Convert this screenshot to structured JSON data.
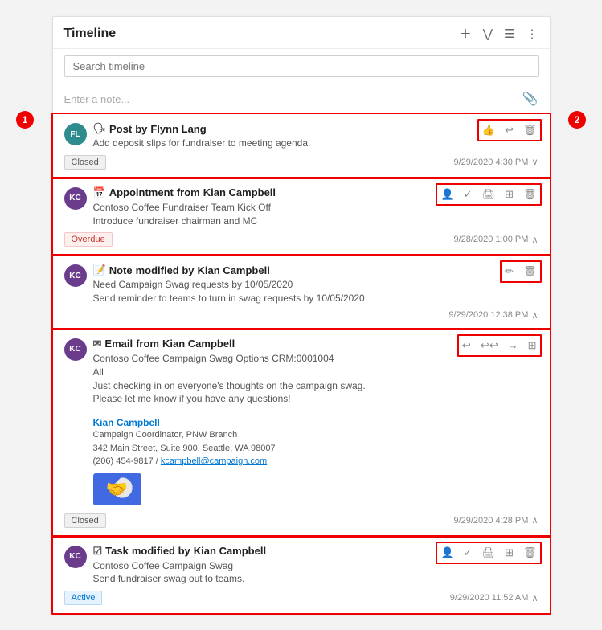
{
  "panel": {
    "title": "Timeline",
    "search_placeholder": "Search timeline",
    "note_placeholder": "Enter a note...",
    "header_actions": [
      "add",
      "filter",
      "sort",
      "more"
    ]
  },
  "annotations": {
    "circle1_label": "1",
    "circle2_label": "2"
  },
  "items": [
    {
      "id": "post-1",
      "type": "Post",
      "type_icon": "🗣",
      "author": "Flynn Lang",
      "avatar_initials": "FL",
      "avatar_class": "avatar-fl",
      "body_lines": [
        "Add deposit slips for fundraiser to meeting agenda."
      ],
      "badge": "Closed",
      "badge_class": "badge-closed",
      "timestamp": "9/29/2020 4:30 PM",
      "collapsed": false,
      "actions": [
        "thumbsup",
        "undo",
        "delete"
      ]
    },
    {
      "id": "appt-1",
      "type": "Appointment",
      "type_icon": "📅",
      "author": "Kian Campbell",
      "avatar_initials": "KC",
      "avatar_class": "avatar-kc",
      "body_lines": [
        "Contoso Coffee Fundraiser Team Kick Off",
        "Introduce fundraiser chairman and MC"
      ],
      "badge": "Overdue",
      "badge_class": "badge-overdue",
      "timestamp": "9/28/2020 1:00 PM",
      "collapsed": false,
      "actions": [
        "assign",
        "check",
        "print",
        "export",
        "delete"
      ]
    },
    {
      "id": "note-1",
      "type": "Note",
      "type_icon": "📝",
      "author": "Kian Campbell",
      "avatar_initials": "KC",
      "avatar_class": "avatar-kc",
      "body_lines": [
        "Need Campaign Swag requests by 10/05/2020",
        "Send reminder to teams to turn in swag requests by 10/05/2020"
      ],
      "badge": null,
      "timestamp": "9/29/2020 12:38 PM",
      "collapsed": false,
      "actions": [
        "edit",
        "delete"
      ]
    },
    {
      "id": "email-1",
      "type": "Email",
      "type_icon": "✉",
      "author": "Kian Campbell",
      "avatar_initials": "KC",
      "avatar_class": "avatar-kc",
      "body_lines": [
        "Contoso Coffee Campaign Swag Options CRM:0001004",
        "All",
        "Just checking in on everyone's thoughts on the campaign swag.",
        "Please let me know if you have any questions!"
      ],
      "has_signature": true,
      "sig_name": "Kian Campbell",
      "sig_title": "Campaign Coordinator, PNW Branch",
      "sig_address": "342 Main Street, Suite 900, Seattle, WA 98007",
      "sig_phone": "(206) 454-9817",
      "sig_email": "kcampbell@campaign.com",
      "badge": "Closed",
      "badge_class": "badge-closed",
      "timestamp": "9/29/2020 4:28 PM",
      "collapsed": false,
      "actions": [
        "reply",
        "reply-all",
        "forward",
        "export"
      ]
    },
    {
      "id": "task-1",
      "type": "Task",
      "type_icon": "☑",
      "author": "Kian Campbell",
      "avatar_initials": "KC",
      "avatar_class": "avatar-kc",
      "body_lines": [
        "Contoso Coffee Campaign Swag",
        "Send fundraiser swag out to teams."
      ],
      "badge": "Active",
      "badge_class": "badge-active",
      "timestamp": "9/29/2020 11:52 AM",
      "collapsed": false,
      "actions": [
        "assign",
        "check",
        "print",
        "export",
        "delete"
      ]
    }
  ]
}
